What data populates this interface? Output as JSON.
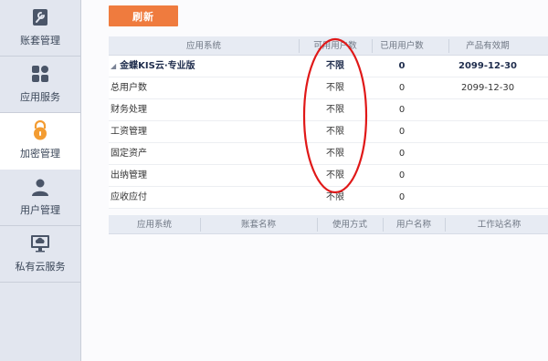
{
  "sidebar": {
    "items": [
      {
        "label": "账套管理",
        "icon": "wrench-icon"
      },
      {
        "label": "应用服务",
        "icon": "apps-grid-icon"
      },
      {
        "label": "加密管理",
        "icon": "lock-icon"
      },
      {
        "label": "用户管理",
        "icon": "user-icon"
      },
      {
        "label": "私有云服务",
        "icon": "monitor-icon"
      }
    ],
    "active_index": 2,
    "active_color": "#f39c32"
  },
  "toolbar": {
    "refresh_label": "刷新",
    "refresh_color": "#ef7b3e"
  },
  "license_table": {
    "columns": [
      "应用系统",
      "可用用户数",
      "已用用户数",
      "产品有效期"
    ],
    "group": {
      "name": "金蝶KIS云·专业版",
      "available": "不限",
      "used": "0",
      "expiry": "2099-12-30"
    },
    "rows": [
      {
        "name": "总用户数",
        "available": "不限",
        "used": "0",
        "expiry": "2099-12-30"
      },
      {
        "name": "财务处理",
        "available": "不限",
        "used": "0",
        "expiry": ""
      },
      {
        "name": "工资管理",
        "available": "不限",
        "used": "0",
        "expiry": ""
      },
      {
        "name": "固定资产",
        "available": "不限",
        "used": "0",
        "expiry": ""
      },
      {
        "name": "出纳管理",
        "available": "不限",
        "used": "0",
        "expiry": ""
      },
      {
        "name": "应收应付",
        "available": "不限",
        "used": "0",
        "expiry": ""
      }
    ]
  },
  "session_table": {
    "columns": [
      "应用系统",
      "账套名称",
      "使用方式",
      "用户名称",
      "工作站名称"
    ]
  },
  "annotation_color": "#e01818"
}
